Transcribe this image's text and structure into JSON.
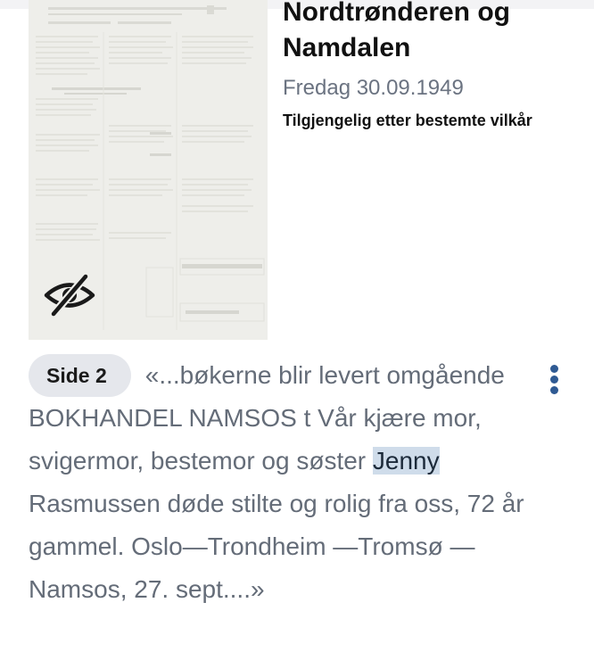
{
  "newspaper": {
    "title": "Nordtrønderen og Namdalen",
    "date": "Fredag 30.09.1949",
    "access_note": "Tilgjengelig etter bestemte vilkår"
  },
  "thumbnail": {
    "icon": "eye-slash-icon"
  },
  "snippet": {
    "page_label": "Side 2",
    "text_before": "«...bøkerne blir levert omgående BOKHANDEL NAMSOS t Vår kjære mor, svigermor, bestemor og søster ",
    "highlight": "Jenny",
    "text_after": " Rasmussen døde stilte og rolig fra oss, 72 år gammel. Oslo—Trondheim —Tromsø — Namsos, 27. sept....»"
  },
  "more_menu": {
    "icon": "vertical-dots-icon"
  },
  "colors": {
    "highlight": "#cfdcea",
    "accent": "#2f5a93",
    "muted_text": "#646c78"
  }
}
